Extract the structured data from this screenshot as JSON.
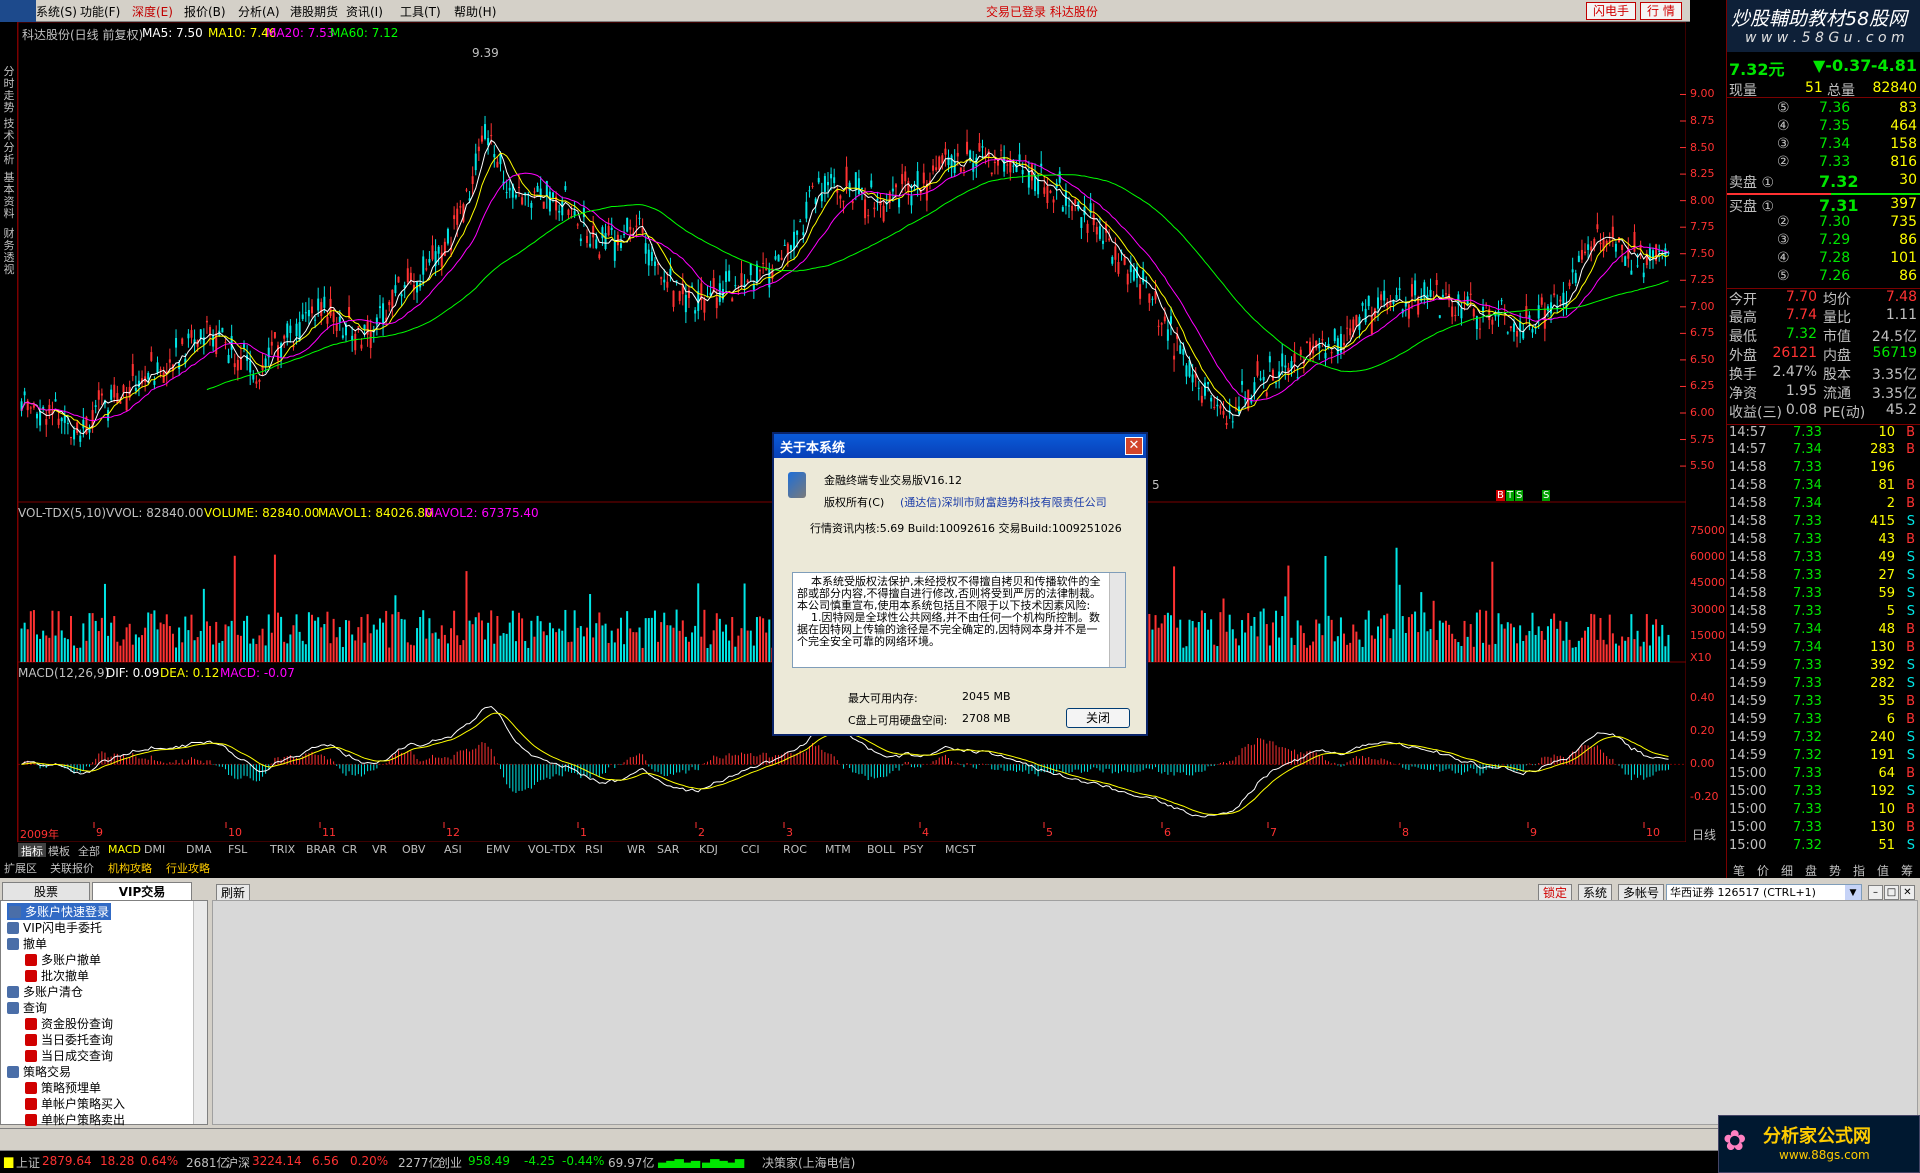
{
  "menubar": {
    "items": [
      "系统(S)",
      "功能(F)",
      "深度(E)",
      "报价(B)",
      "分析(A)",
      "港股期货",
      "资讯(I)",
      "工具(T)",
      "帮助(H)"
    ],
    "status": "交易已登录  科达股份",
    "btn_flash": "闪电手",
    "btn_trade": "行  情"
  },
  "vtabs": [
    "分时走势",
    "技术分析",
    "基本资料",
    "财务透视"
  ],
  "chart": {
    "title_row": {
      "name": "科达股份(日线 前复权)",
      "ma5": "MA5: 7.50",
      "ma10": "MA10: 7.46",
      "ma20": "MA20: 7.53",
      "ma60": "MA60: 7.12"
    },
    "peak_label": "9.39",
    "low_label": "5",
    "price_ticks": [
      "9.00",
      "8.75",
      "8.50",
      "8.25",
      "8.00",
      "7.75",
      "7.50",
      "7.25",
      "7.00",
      "6.75",
      "6.50",
      "6.25",
      "6.00",
      "5.75",
      "5.50"
    ],
    "vol_row": {
      "name": "VOL-TDX(5,10)",
      "vvol": "VVOL: 82840.00",
      "volume": "VOLUME: 82840.00",
      "mavol1": "MAVOL1: 84026.80",
      "mavol2": "MAVOL2: 67375.40"
    },
    "vol_ticks": [
      "75000",
      "60000",
      "45000",
      "30000",
      "15000",
      "X10"
    ],
    "macd_row": {
      "name": "MACD(12,26,9)",
      "dif": "DIF: 0.09",
      "dea": "DEA: 0.12",
      "macd": "MACD: -0.07"
    },
    "macd_ticks": [
      "0.40",
      "0.20",
      "0.00",
      "-0.20"
    ],
    "bts": [
      "B",
      "T",
      "S",
      "S"
    ],
    "date_axis": [
      "2009年",
      "9",
      "10",
      "11",
      "12",
      "1",
      "2",
      "3",
      "4",
      "5",
      "6",
      "7",
      "8",
      "9",
      "10"
    ],
    "period_label": "日线",
    "indicator_tabs": [
      "指标",
      "模板",
      "全部",
      "MACD",
      "DMI",
      "DMA",
      "FSL",
      "TRIX",
      "BRAR",
      "CR",
      "VR",
      "OBV",
      "ASI",
      "EMV",
      "VOL-TDX",
      "RSI",
      "WR",
      "SAR",
      "KDJ",
      "CCI",
      "ROC",
      "MTM",
      "BOLL",
      "PSY",
      "MCST"
    ],
    "ext_tabs": [
      "扩展区",
      "关联报价",
      "机构攻略",
      "行业攻略"
    ]
  },
  "dialog": {
    "title": "关于本系统",
    "product": "金融终端专业交易版V16.12",
    "copyright_label": "版权所有(C)",
    "copyright_holder": "(通达信)深圳市财富趋势科技有限责任公司",
    "build": "行情资讯内核:5.69 Build:10092616  交易Build:1009251026",
    "license": "    本系统受版权法保护,未经授权不得擅自拷贝和传播软件的全部或部分内容,不得擅自进行修改,否则将受到严厉的法律制裁。本公司慎重宣布,使用本系统包括且不限于以下技术因素风险:\n    1.因特网是全球性公共网络,并不由任何一个机构所控制。数据在因特网上传输的途径是不完全确定的,因特网本身并不是一个完全安全可靠的网络环境。",
    "mem_label": "最大可用内存:",
    "mem_value": "2045 MB",
    "disk_label": "C盘上可用硬盘空间:",
    "disk_value": "2708 MB",
    "ok": "关闭"
  },
  "right": {
    "logo_text": "炒股輔助教材58股网",
    "logo_url": "w w w . 5 8 G u . c o m",
    "price": "7.32元",
    "change": "▼-0.37",
    "pct": "-4.81",
    "xianliang_label": "现量",
    "xianliang": "51",
    "zongliang_label": "总量",
    "zongliang": "82840",
    "sells": [
      {
        "lvl": "⑤",
        "p": "7.36",
        "v": "83"
      },
      {
        "lvl": "④",
        "p": "7.35",
        "v": "464"
      },
      {
        "lvl": "③",
        "p": "7.34",
        "v": "158"
      },
      {
        "lvl": "②",
        "p": "7.33",
        "v": "816"
      },
      {
        "lvl": "卖盘 ①",
        "p": "7.32",
        "v": "30"
      }
    ],
    "buys": [
      {
        "lvl": "买盘 ①",
        "p": "7.31",
        "v": "397"
      },
      {
        "lvl": "②",
        "p": "7.30",
        "v": "735"
      },
      {
        "lvl": "③",
        "p": "7.29",
        "v": "86"
      },
      {
        "lvl": "④",
        "p": "7.28",
        "v": "101"
      },
      {
        "lvl": "⑤",
        "p": "7.26",
        "v": "86"
      }
    ],
    "stats": [
      {
        "l1": "今开",
        "v1": "7.70",
        "l2": "均价",
        "v2": "7.48"
      },
      {
        "l1": "最高",
        "v1": "7.74",
        "l2": "量比",
        "v2": "1.11"
      },
      {
        "l1": "最低",
        "v1": "7.32",
        "l2": "市值",
        "v2": "24.5亿"
      },
      {
        "l1": "外盘",
        "v1": "26121",
        "l2": "内盘",
        "v2": "56719"
      },
      {
        "l1": "换手",
        "v1": "2.47%",
        "l2": "股本",
        "v2": "3.35亿"
      },
      {
        "l1": "净资",
        "v1": "1.95",
        "l2": "流通",
        "v2": "3.35亿"
      },
      {
        "l1": "收益(三)",
        "v1": "0.08",
        "l2": "PE(动)",
        "v2": "45.2"
      }
    ],
    "ticks": [
      {
        "t": "14:57",
        "p": "7.33",
        "v": "10",
        "d": "B"
      },
      {
        "t": "14:57",
        "p": "7.34",
        "v": "283",
        "d": "B"
      },
      {
        "t": "14:58",
        "p": "7.33",
        "v": "196",
        "d": ""
      },
      {
        "t": "14:58",
        "p": "7.34",
        "v": "81",
        "d": "B"
      },
      {
        "t": "14:58",
        "p": "7.34",
        "v": "2",
        "d": "B"
      },
      {
        "t": "14:58",
        "p": "7.33",
        "v": "415",
        "d": "S"
      },
      {
        "t": "14:58",
        "p": "7.33",
        "v": "43",
        "d": "B"
      },
      {
        "t": "14:58",
        "p": "7.33",
        "v": "49",
        "d": "S"
      },
      {
        "t": "14:58",
        "p": "7.33",
        "v": "27",
        "d": "S"
      },
      {
        "t": "14:58",
        "p": "7.33",
        "v": "59",
        "d": "S"
      },
      {
        "t": "14:58",
        "p": "7.33",
        "v": "5",
        "d": "S"
      },
      {
        "t": "14:59",
        "p": "7.34",
        "v": "48",
        "d": "B"
      },
      {
        "t": "14:59",
        "p": "7.34",
        "v": "130",
        "d": "B"
      },
      {
        "t": "14:59",
        "p": "7.33",
        "v": "392",
        "d": "S"
      },
      {
        "t": "14:59",
        "p": "7.33",
        "v": "282",
        "d": "S"
      },
      {
        "t": "14:59",
        "p": "7.33",
        "v": "35",
        "d": "B"
      },
      {
        "t": "14:59",
        "p": "7.33",
        "v": "6",
        "d": "B"
      },
      {
        "t": "14:59",
        "p": "7.32",
        "v": "240",
        "d": "S"
      },
      {
        "t": "14:59",
        "p": "7.32",
        "v": "191",
        "d": "S"
      },
      {
        "t": "15:00",
        "p": "7.33",
        "v": "64",
        "d": "B"
      },
      {
        "t": "15:00",
        "p": "7.33",
        "v": "192",
        "d": "S"
      },
      {
        "t": "15:00",
        "p": "7.33",
        "v": "10",
        "d": "B"
      },
      {
        "t": "15:00",
        "p": "7.33",
        "v": "130",
        "d": "B"
      },
      {
        "t": "15:00",
        "p": "7.32",
        "v": "51",
        "d": "S"
      }
    ],
    "bottom_tabs": [
      "笔",
      "价",
      "细",
      "盘",
      "势",
      "指",
      "值",
      "筹"
    ]
  },
  "bottom": {
    "tab_stock": "股票",
    "tab_vip": "VIP交易",
    "refresh": "刷新",
    "lock": "锁定",
    "system": "系统",
    "multi": "多帐号",
    "account": "华西证券 126517 (CTRL+1)",
    "tree": [
      {
        "lvl": 0,
        "t": "多账户快速登录",
        "sel": true
      },
      {
        "lvl": 0,
        "t": "VIP闪电手委托"
      },
      {
        "lvl": 0,
        "t": "撤单"
      },
      {
        "lvl": 1,
        "t": "多账户撤单"
      },
      {
        "lvl": 1,
        "t": "批次撤单"
      },
      {
        "lvl": 0,
        "t": "多账户清仓"
      },
      {
        "lvl": 0,
        "t": "查询"
      },
      {
        "lvl": 1,
        "t": "资金股份查询"
      },
      {
        "lvl": 1,
        "t": "当日委托查询"
      },
      {
        "lvl": 1,
        "t": "当日成交查询"
      },
      {
        "lvl": 0,
        "t": "策略交易"
      },
      {
        "lvl": 1,
        "t": "策略预埋单"
      },
      {
        "lvl": 1,
        "t": "单帐户策略买入"
      },
      {
        "lvl": 1,
        "t": "单帐户策略卖出"
      }
    ]
  },
  "status": {
    "sh_label": "上证",
    "sh": "2879.64",
    "sh_chg": "18.28",
    "sh_pct": "0.64%",
    "sh_amt": "2681亿",
    "sz_label": "沪深",
    "sz": "3224.14",
    "sz_chg": "6.56",
    "sz_pct": "0.20%",
    "sz_amt": "2277亿",
    "cy_label": "创业",
    "cy": "958.49",
    "cy_chg": "-4.25",
    "cy_pct": "-0.44%",
    "cy_amt": "69.97亿",
    "broker": "决策家(上海电信)",
    "watermark": "分析家公式网",
    "watermark_url": "www.88gs.com"
  },
  "colors": {
    "up": "#ff3232",
    "down": "#00e6e6",
    "ma5": "#ffffff",
    "ma10": "#ffff00",
    "ma20": "#ff00ff",
    "ma60": "#00ff00"
  }
}
